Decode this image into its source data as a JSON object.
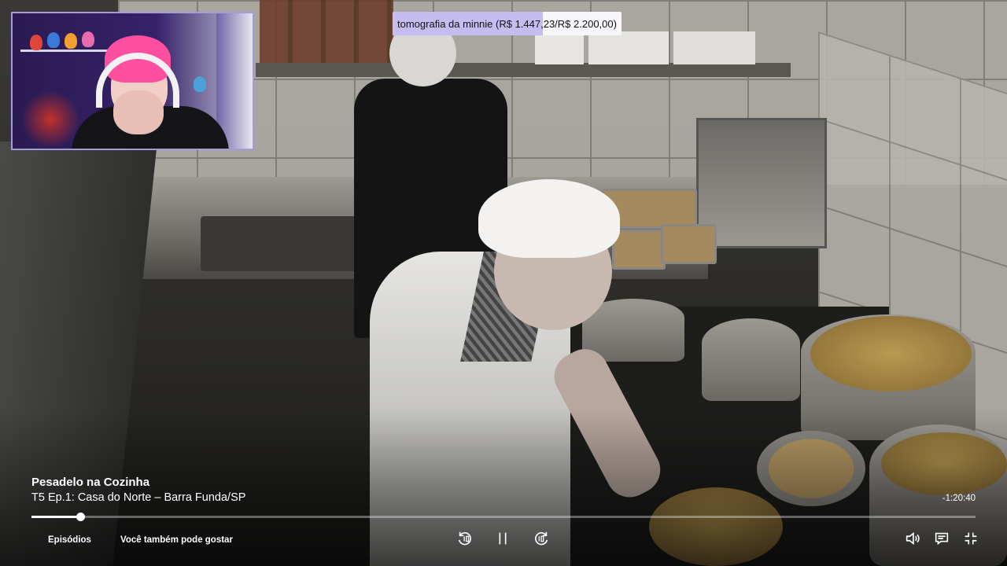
{
  "overlay": {
    "donation_text": "tomografia da minnie (R$ 1.447,23/R$ 2.200,00)",
    "donation_raised": 1447.23,
    "donation_goal": 2200.0
  },
  "player": {
    "show_title": "Pesadelo na Cozinha",
    "episode_title": "T5 Ep.1: Casa do Norte – Barra Funda/SP",
    "time_remaining": "-1:20:40",
    "progress_fraction": 0.052,
    "links": {
      "episodes": "Episódios",
      "you_may_also_like": "Você também pode gostar"
    },
    "icons": {
      "rewind": "rewind-10-icon",
      "pause": "pause-icon",
      "forward": "forward-10-icon",
      "volume": "volume-icon",
      "subtitles": "subtitles-icon",
      "exit_fullscreen": "exit-fullscreen-icon"
    },
    "accent_color": "#ffffff"
  }
}
